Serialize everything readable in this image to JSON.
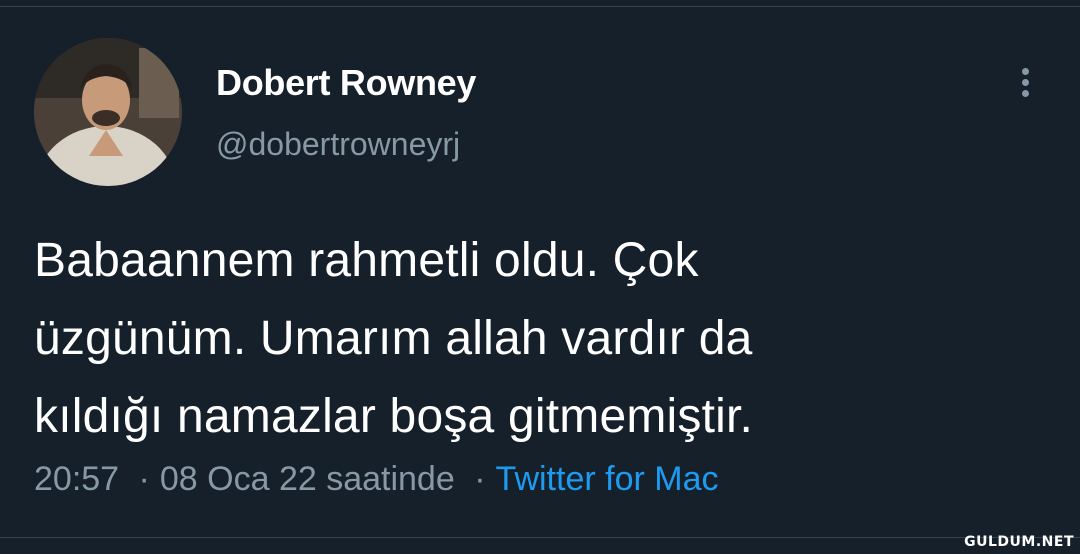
{
  "tweet": {
    "author": {
      "display_name": "Dobert Rowney",
      "handle": "@dobertrowneyrj",
      "avatar_icon": "user-avatar-photo"
    },
    "more_icon": "more-vertical-icon",
    "text_lines": [
      "Babaannem rahmetli oldu. Çok",
      "üzgünüm. Umarım allah vardır da",
      "kıldığı namazlar boşa gitmemiştir."
    ],
    "time": "20:57",
    "date": "08 Oca 22 saatinde",
    "separator": "·",
    "source": "Twitter for Mac"
  },
  "watermark": "GULDUM.NET",
  "colors": {
    "background": "#15202b",
    "text": "#ffffff",
    "secondary": "#8899a6",
    "link": "#1d9bf0",
    "divider": "#38444d"
  }
}
